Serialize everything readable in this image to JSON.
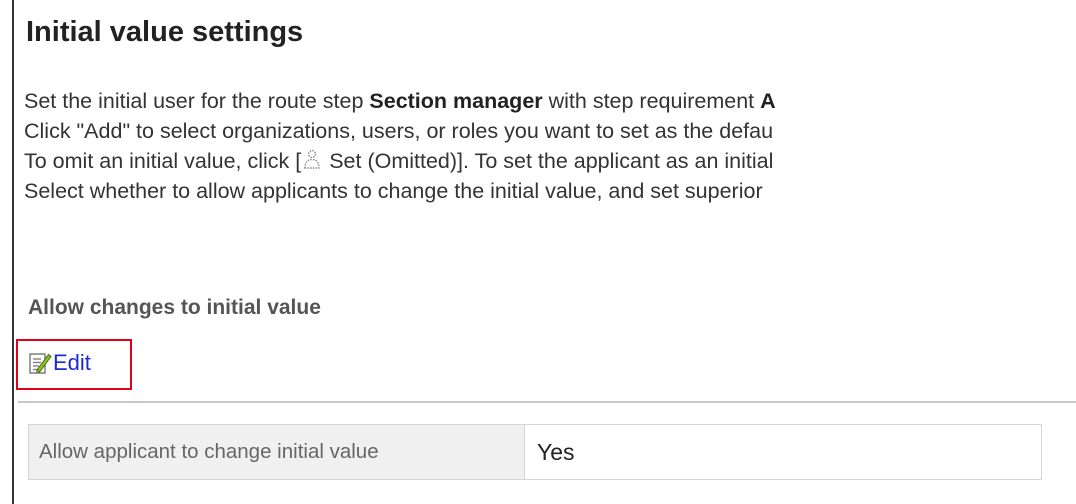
{
  "page": {
    "title": "Initial value settings"
  },
  "description": {
    "line1": {
      "before": "Set the initial user for the route step ",
      "bold": "Section manager",
      "after": " with step requirement ",
      "trailing_bold": "A"
    },
    "line2": "Click \"Add\" to select organizations, users, or roles you want to set as the defau",
    "line3": {
      "before": "To omit an initial value, click [",
      "icon": "person-icon",
      "after": " Set (Omitted)]. To set the applicant as an initial"
    },
    "line4": "Select whether to allow applicants to change the initial value, and set superior"
  },
  "section": {
    "heading": "Allow changes to initial value"
  },
  "edit_link": {
    "label": "Edit",
    "icon": "edit-icon",
    "highlight_color": "#e0001b",
    "link_color": "#1a2bd6"
  },
  "settings": [
    {
      "label": "Allow applicant to change initial value",
      "value": "Yes"
    }
  ]
}
